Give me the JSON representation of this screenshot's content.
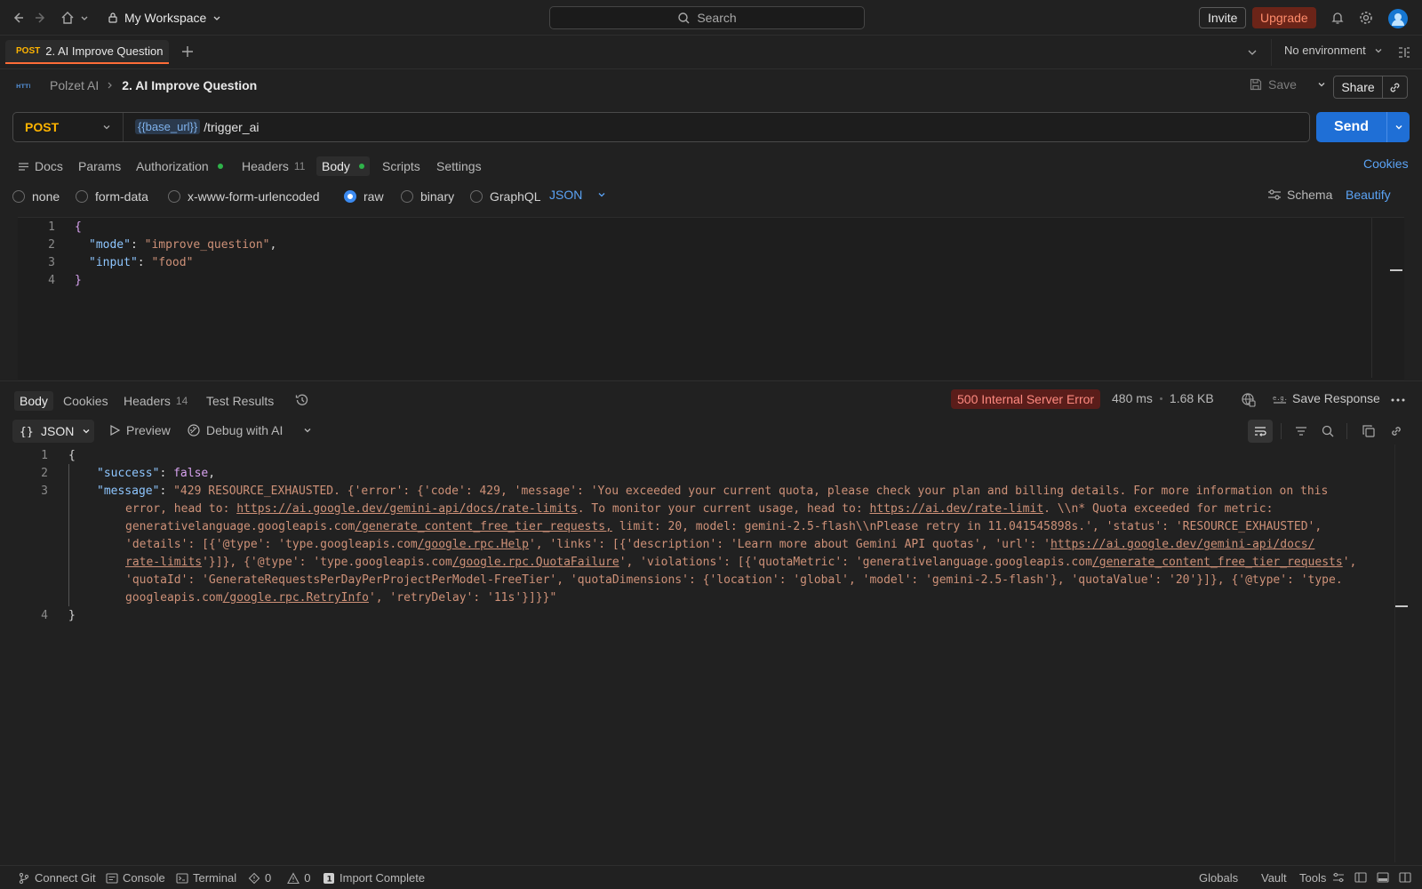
{
  "topbar": {
    "workspace": "My Workspace",
    "search_placeholder": "Search",
    "invite": "Invite",
    "upgrade": "Upgrade"
  },
  "tabs": [
    {
      "method": "POST",
      "name": "2. AI Improve Question"
    }
  ],
  "environment": "No environment",
  "breadcrumb": {
    "collection": "Polzet AI",
    "request": "2. AI Improve Question"
  },
  "actions": {
    "save": "Save",
    "share": "Share"
  },
  "request": {
    "method": "POST",
    "url_variable": "{{base_url}}",
    "url_path": "/trigger_ai",
    "send": "Send"
  },
  "request_tabs": {
    "docs": "Docs",
    "params": "Params",
    "authorization": "Authorization",
    "headers": "Headers",
    "headers_count": "11",
    "body": "Body",
    "scripts": "Scripts",
    "settings": "Settings",
    "cookies": "Cookies"
  },
  "body_types": {
    "none": "none",
    "form_data": "form-data",
    "urlencoded": "x-www-form-urlencoded",
    "raw": "raw",
    "binary": "binary",
    "graphql": "GraphQL",
    "selected_format": "JSON",
    "schema": "Schema",
    "beautify": "Beautify"
  },
  "request_body": {
    "open": "{",
    "mode_key": "\"mode\"",
    "mode_value": "\"improve_question\"",
    "input_key": "\"input\"",
    "input_value": "\"food\"",
    "close": "}"
  },
  "response_tabs": {
    "body": "Body",
    "cookies": "Cookies",
    "headers": "Headers",
    "headers_count": "14",
    "test_results": "Test Results"
  },
  "response_meta": {
    "status": "500 Internal Server Error",
    "time": "480 ms",
    "size": "1.68 KB",
    "save_response": "Save Response"
  },
  "response_toolbar": {
    "format": "JSON",
    "preview": "Preview",
    "debug": "Debug with AI"
  },
  "response_body": {
    "open": "{",
    "success_key": "\"success\"",
    "success_value": "false",
    "message_key": "\"message\"",
    "line3_a": "\"429 RESOURCE_EXHAUSTED. {'error': {'code': 429, 'message': 'You exceeded your current quota, please check your plan and billing details. For more information on this",
    "line3_b1": "error, head to: ",
    "line3_b_link1": "https://ai.google.dev/gemini-api/docs/rate-limits",
    "line3_b2": ". To monitor your current usage, head to: ",
    "line3_b_link2": "https://ai.dev/rate-limit",
    "line3_b3": ". \\\\n* Quota exceeded for metric:",
    "line3_c1": "generativelanguage.googleapis.com",
    "line3_c_link": "/generate_content_free_tier_requests,",
    "line3_c2": " limit: 20, model: gemini-2.5-flash\\\\nPlease retry in 11.041545898s.', 'status': 'RESOURCE_EXHAUSTED',",
    "line3_d1": "'details': [{'@type': 'type.googleapis.com",
    "line3_d_link1": "/google.rpc.Help",
    "line3_d2": "', 'links': [{'description': 'Learn more about Gemini API quotas', 'url': '",
    "line3_d_link2": "https://ai.google.dev/gemini-api/docs/",
    "line3_e_link1": "rate-limits",
    "line3_e1": "'}]}, {'@type': 'type.googleapis.com",
    "line3_e_link2": "/google.rpc.QuotaFailure",
    "line3_e2": "', 'violations': [{'quotaMetric': 'generativelanguage.googleapis.com",
    "line3_e_link3": "/generate_content_free_tier_requests",
    "line3_e3": "',",
    "line3_f": "'quotaId': 'GenerateRequestsPerDayPerProjectPerModel-FreeTier', 'quotaDimensions': {'location': 'global', 'model': 'gemini-2.5-flash'}, 'quotaValue': '20'}]}, {'@type': 'type.",
    "line3_g1": "googleapis.com",
    "line3_g_link": "/google.rpc.RetryInfo",
    "line3_g2": "', 'retryDelay': '11s'}]}}\"",
    "close": "}"
  },
  "statusbar": {
    "connect_git": "Connect Git",
    "console": "Console",
    "terminal": "Terminal",
    "errors": "0",
    "warnings": "0",
    "import": "Import Complete",
    "globals": "Globals",
    "vault": "Vault",
    "tools": "Tools"
  },
  "colors": {
    "accent": "#ff6c37",
    "send": "#1f6fd6",
    "link": "#5ba3f5",
    "method_post": "#ffb400",
    "error_bg": "#5a1d1a",
    "error_text": "#ff8a80"
  }
}
